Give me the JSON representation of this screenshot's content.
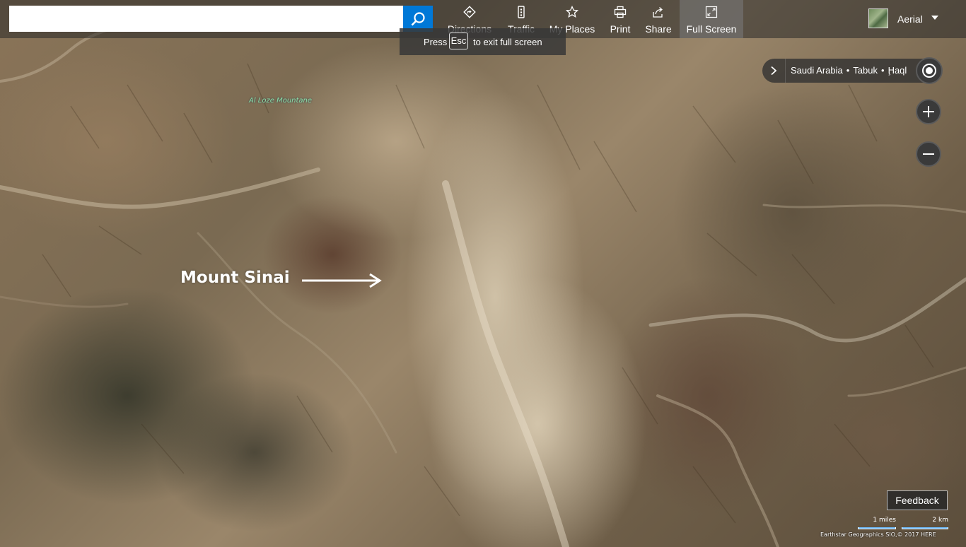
{
  "search": {
    "placeholder": "",
    "value": ""
  },
  "nav": {
    "directions": "Directions",
    "traffic": "Traffic",
    "my_places": "My Places",
    "print": "Print",
    "share": "Share",
    "full_screen": "Full Screen"
  },
  "map_style": {
    "label": "Aerial"
  },
  "tooltip": {
    "press": "Press",
    "key": "Esc",
    "rest": "to exit full screen"
  },
  "breadcrumb": {
    "items": [
      "Saudi Arabia",
      "Tabuk",
      "Ḩaql"
    ]
  },
  "map": {
    "area_label": "Al Loze Mountane",
    "annotation": "Mount Sinai"
  },
  "feedback": "Feedback",
  "scale": {
    "miles": "1 miles",
    "km": "2 km"
  },
  "copyright": "Earthstar Geographics SIO,© 2017 HERE",
  "icons": {
    "search": "search-icon",
    "directions": "directions-icon",
    "traffic": "traffic-icon",
    "my_places": "star-icon",
    "print": "print-icon",
    "share": "share-icon",
    "full_screen": "fullscreen-icon",
    "locate": "locate-icon",
    "zoom_in": "plus-icon",
    "zoom_out": "minus-icon",
    "expand": "chevron-right-icon"
  },
  "colors": {
    "accent": "#0078d7",
    "area_label": "#8fe0a8"
  }
}
